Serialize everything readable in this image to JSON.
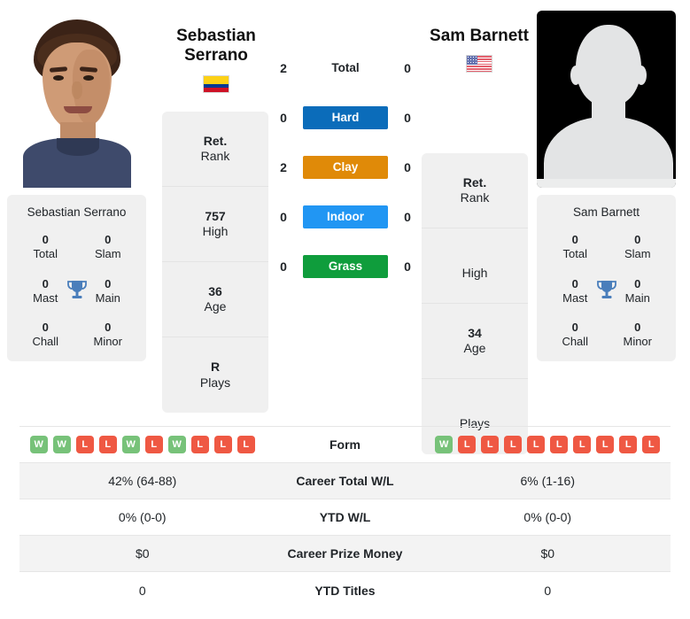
{
  "players": {
    "left": {
      "name_line1": "Sebastian",
      "name_line2": "Serrano",
      "country": "Colombia",
      "card_name": "Sebastian Serrano",
      "titles": [
        {
          "value": "0",
          "label": "Total"
        },
        {
          "value": "0",
          "label": "Slam"
        },
        {
          "value": "0",
          "label": "Mast"
        },
        {
          "value": "0",
          "label": "Main"
        },
        {
          "value": "0",
          "label": "Chall"
        },
        {
          "value": "0",
          "label": "Minor"
        }
      ],
      "info": [
        {
          "value": "Ret.",
          "label": "Rank"
        },
        {
          "value": "757",
          "label": "High"
        },
        {
          "value": "36",
          "label": "Age"
        },
        {
          "value": "R",
          "label": "Plays"
        }
      ],
      "form": [
        "W",
        "W",
        "L",
        "L",
        "W",
        "L",
        "W",
        "L",
        "L",
        "L"
      ],
      "career_total_wl": "42% (64-88)",
      "ytd_wl": "0% (0-0)",
      "career_prize_money": "$0",
      "ytd_titles": "0"
    },
    "right": {
      "name_line1": "Sam Barnett",
      "name_line2": "",
      "country": "United States",
      "card_name": "Sam Barnett",
      "titles": [
        {
          "value": "0",
          "label": "Total"
        },
        {
          "value": "0",
          "label": "Slam"
        },
        {
          "value": "0",
          "label": "Mast"
        },
        {
          "value": "0",
          "label": "Main"
        },
        {
          "value": "0",
          "label": "Chall"
        },
        {
          "value": "0",
          "label": "Minor"
        }
      ],
      "info": [
        {
          "value": "Ret.",
          "label": "Rank"
        },
        {
          "value": "",
          "label": "High"
        },
        {
          "value": "34",
          "label": "Age"
        },
        {
          "value": "",
          "label": "Plays"
        }
      ],
      "form": [
        "W",
        "L",
        "L",
        "L",
        "L",
        "L",
        "L",
        "L",
        "L",
        "L"
      ],
      "career_total_wl": "6% (1-16)",
      "ytd_wl": "0% (0-0)",
      "career_prize_money": "$0",
      "ytd_titles": "0"
    }
  },
  "surfaces": [
    {
      "label": "Total",
      "left": "2",
      "right": "0",
      "color": ""
    },
    {
      "label": "Hard",
      "left": "0",
      "right": "0",
      "color": "#0b6cba"
    },
    {
      "label": "Clay",
      "left": "2",
      "right": "0",
      "color": "#e08a08"
    },
    {
      "label": "Indoor",
      "left": "0",
      "right": "0",
      "color": "#2196f3"
    },
    {
      "label": "Grass",
      "left": "0",
      "right": "0",
      "color": "#0f9d3c"
    }
  ],
  "table": {
    "form_label": "Form",
    "rows": [
      {
        "label": "Career Total W/L",
        "left": "42% (64-88)",
        "right": "6% (1-16)"
      },
      {
        "label": "YTD W/L",
        "left": "0% (0-0)",
        "right": "0% (0-0)"
      },
      {
        "label": "Career Prize Money",
        "left": "$0",
        "right": "$0"
      },
      {
        "label": "YTD Titles",
        "left": "0",
        "right": "0"
      }
    ]
  },
  "colors": {
    "win": "#77c279",
    "loss": "#ef5843",
    "card_bg": "#f0f0f0"
  }
}
